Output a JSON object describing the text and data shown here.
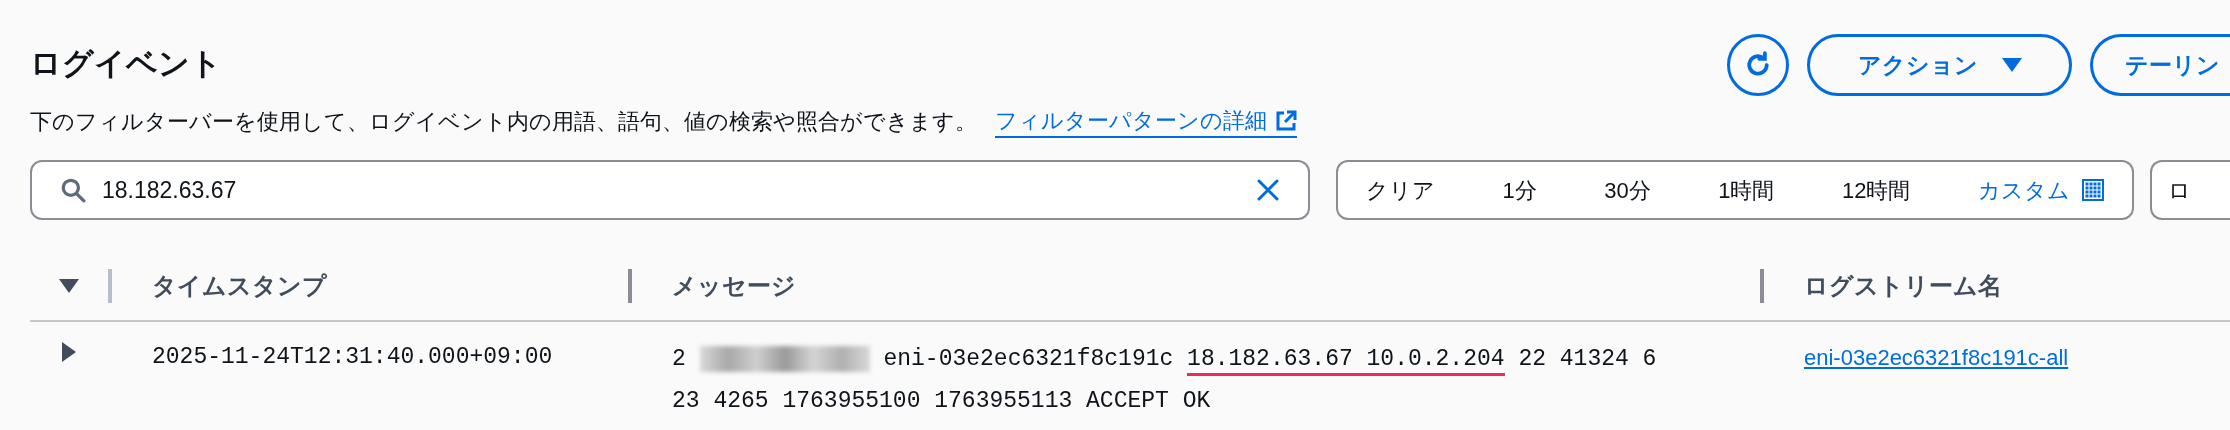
{
  "header": {
    "title": "ログイベント",
    "description": "下のフィルターバーを使用して、ログイベント内の用語、語句、値の検索や照合ができます。",
    "help_link": "フィルターパターンの詳細",
    "buttons": [
      {
        "kind": "refresh"
      },
      {
        "kind": "dropdown",
        "label": "アクション"
      },
      {
        "kind": "plain",
        "label": "テーリン"
      }
    ]
  },
  "filter": {
    "value": "18.182.63.67"
  },
  "time_range": [
    {
      "label": "クリア",
      "kind": "preset"
    },
    {
      "label": "1分",
      "kind": "preset"
    },
    {
      "label": "30分",
      "kind": "preset"
    },
    {
      "label": "1時間",
      "kind": "preset"
    },
    {
      "label": "12時間",
      "kind": "preset"
    },
    {
      "label": "カスタム",
      "kind": "custom"
    }
  ],
  "extra_control": {
    "label": "ロ"
  },
  "table": {
    "columns": [
      "タイムスタンプ",
      "メッセージ",
      "ログストリーム名"
    ],
    "rows": [
      {
        "expanded": false,
        "timestamp": "2025-11-24T12:31:40.000+09:00",
        "message": {
          "before": "2",
          "redacted": true,
          "middle": "eni-03e2ec6321f8c191c",
          "highlight": "18.182.63.67 10.0.2.204",
          "after": "22 41324 6 23 4265 1763955100 1763955113 ACCEPT OK"
        },
        "stream": "eni-03e2ec6321f8c191c-all"
      }
    ]
  }
}
